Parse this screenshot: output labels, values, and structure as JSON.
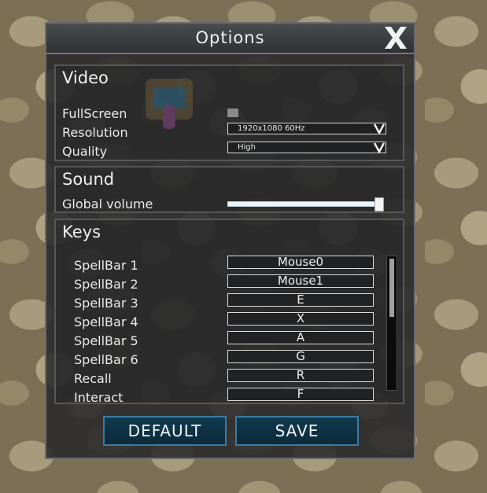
{
  "window": {
    "title": "Options",
    "close_icon": "close-x-icon"
  },
  "video": {
    "title": "Video",
    "fullscreen_label": "FullScreen",
    "fullscreen_checked": false,
    "resolution_label": "Resolution",
    "resolution_value": "1920x1080 60Hz",
    "quality_label": "Quality",
    "quality_value": "High"
  },
  "sound": {
    "title": "Sound",
    "volume_label": "Global volume",
    "volume_level": 1.0
  },
  "keys": {
    "title": "Keys",
    "bindings": [
      {
        "action": "SpellBar 1",
        "key": "Mouse0"
      },
      {
        "action": "SpellBar 2",
        "key": "Mouse1"
      },
      {
        "action": "SpellBar 3",
        "key": "E"
      },
      {
        "action": "SpellBar 4",
        "key": "X"
      },
      {
        "action": "SpellBar 5",
        "key": "A"
      },
      {
        "action": "SpellBar 6",
        "key": "G"
      },
      {
        "action": "Recall",
        "key": "R"
      },
      {
        "action": "Interact",
        "key": "F"
      }
    ]
  },
  "buttons": {
    "default_label": "DEFAULT",
    "save_label": "SAVE"
  },
  "colors": {
    "accent": "#3d7aa0",
    "button_bg": "#0f3346",
    "panel_bg": "#26282a",
    "background_stone": "#7d6f55"
  }
}
